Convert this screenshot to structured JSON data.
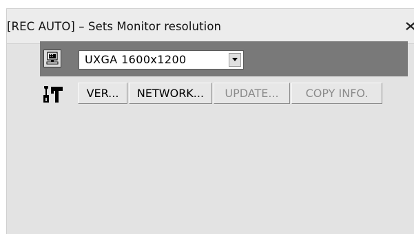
{
  "window": {
    "title": "[REC AUTO] – Sets Monitor resolution",
    "close_icon": "close-icon"
  },
  "resolution": {
    "icon": "monitor-icon",
    "selected": "UXGA 1600x1200"
  },
  "toolbar": {
    "icon": "tools-icon",
    "buttons": [
      {
        "label": "VER...",
        "enabled": true
      },
      {
        "label": "NETWORK...",
        "enabled": true
      },
      {
        "label": "UPDATE...",
        "enabled": false
      },
      {
        "label": "COPY INFO.",
        "enabled": false
      }
    ]
  },
  "colors": {
    "window_bg": "#e3e3e3",
    "titlebar_bg": "#ececec",
    "row_bar": "#797979",
    "disabled_text": "#8b8b8b"
  }
}
